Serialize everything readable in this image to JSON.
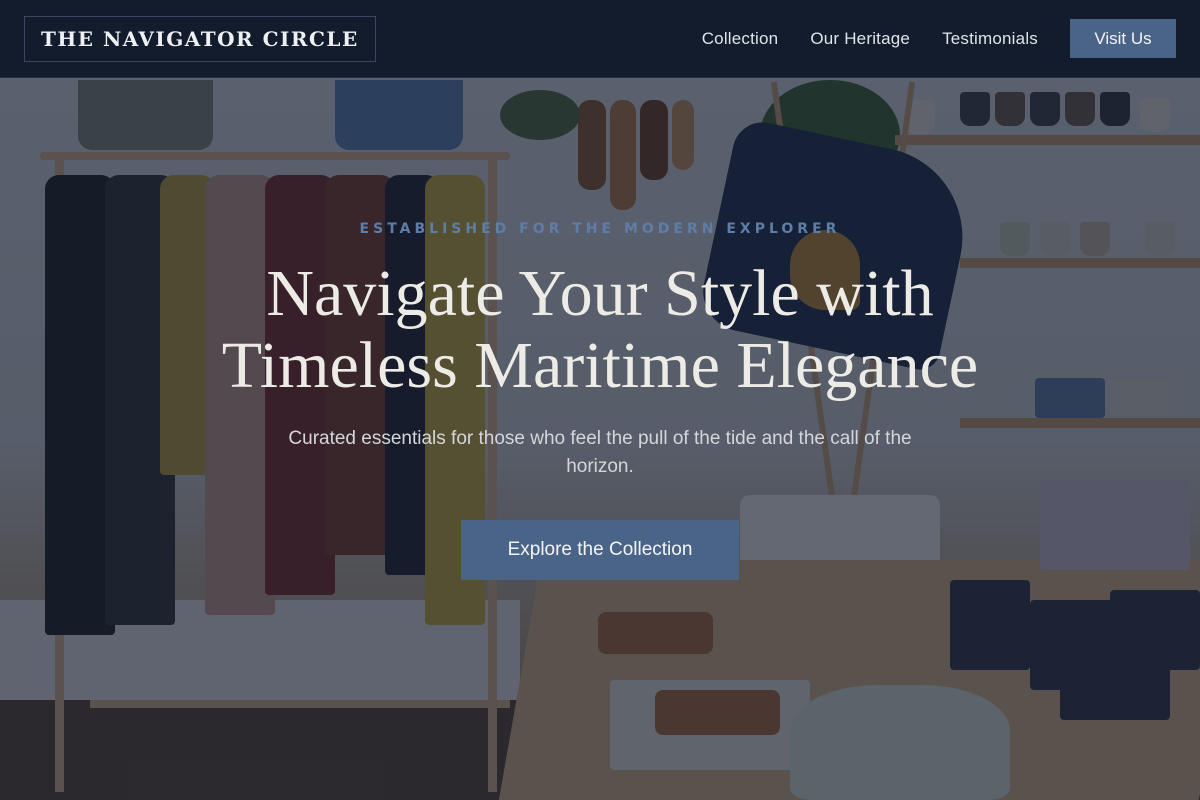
{
  "brand": {
    "name": "THE NAVIGATOR CIRCLE"
  },
  "nav": {
    "links": [
      "Collection",
      "Our Heritage",
      "Testimonials"
    ],
    "cta_label": "Visit Us"
  },
  "hero": {
    "eyebrow": "ESTABLISHED FOR THE MODERN EXPLORER",
    "title_line1": "Navigate Your Style with",
    "title_line2": "Timeless Maritime Elegance",
    "subtitle": "Curated essentials for those who feel the pull of the tide and the call of the horizon.",
    "cta_label": "Explore the Collection"
  },
  "colors": {
    "header_bg": "#121c2c",
    "accent": "#4a6487",
    "eyebrow": "#5d7ea8",
    "overlay": "rgba(18,27,44,0.64)"
  }
}
